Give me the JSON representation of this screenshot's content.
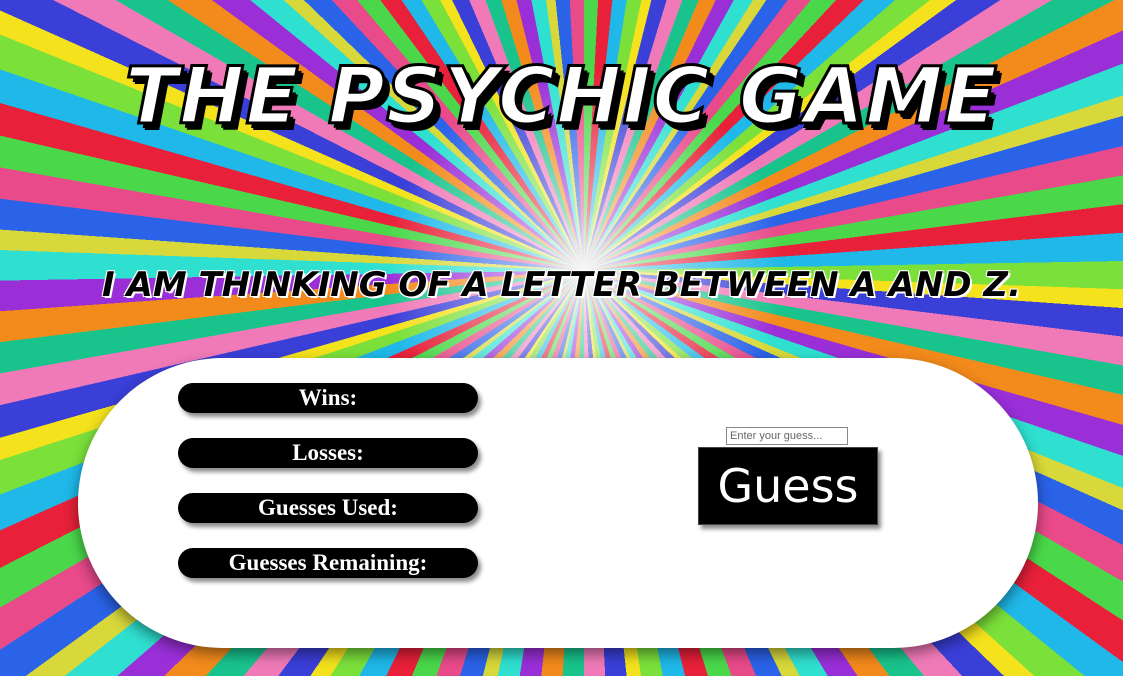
{
  "header": {
    "title": "THE PSYCHIC GAME",
    "subtitle": "I AM THINKING OF A LETTER BETWEEN A AND Z."
  },
  "stats": {
    "wins_label": "Wins:",
    "losses_label": "Losses:",
    "guesses_used_label": "Guesses Used:",
    "guesses_remaining_label": "Guesses Remaining:"
  },
  "guess": {
    "input_value": "",
    "placeholder": "Enter your guess...",
    "button_label": "Guess"
  },
  "colors": {
    "panel": "#ffffff",
    "stat_pill": "#000000",
    "button": "#000000",
    "text_on_dark": "#ffffff"
  }
}
